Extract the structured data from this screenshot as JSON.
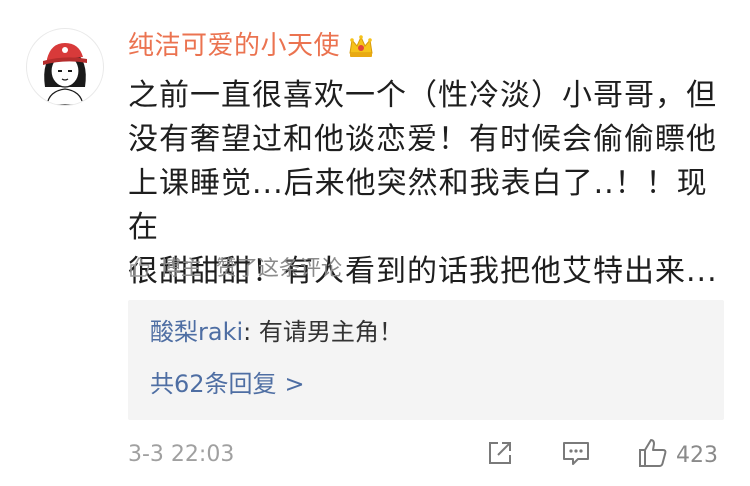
{
  "comment": {
    "username": "纯洁可爱的小天使",
    "body": "之前一直很喜欢一个（性冷淡）小哥哥，但\n没有奢望过和他谈恋爱！有时候会偷偷瞟他\n上课睡觉...后来他突然和我表白了..！！现在\n很甜甜甜！有人看到的话我把他艾特出来...",
    "liked_by_author": {
      "author_tag": "博主",
      "text": "赞了这条评论"
    },
    "reply": {
      "user": "酸梨raki",
      "separator": ": ",
      "text": "有请男主角！",
      "more_label": "共62条回复",
      "more_chevron": ">"
    },
    "timestamp": "3-3 22:03",
    "like_count": "423"
  },
  "icons": {
    "crown": "crown-badge-icon",
    "share": "share-icon",
    "comment": "comment-icon",
    "like": "thumbs-up-icon"
  },
  "colors": {
    "username": "#eb7350",
    "link": "#4e6ea3",
    "muted": "#8a8a8a",
    "reply_bg": "#f4f4f4"
  }
}
